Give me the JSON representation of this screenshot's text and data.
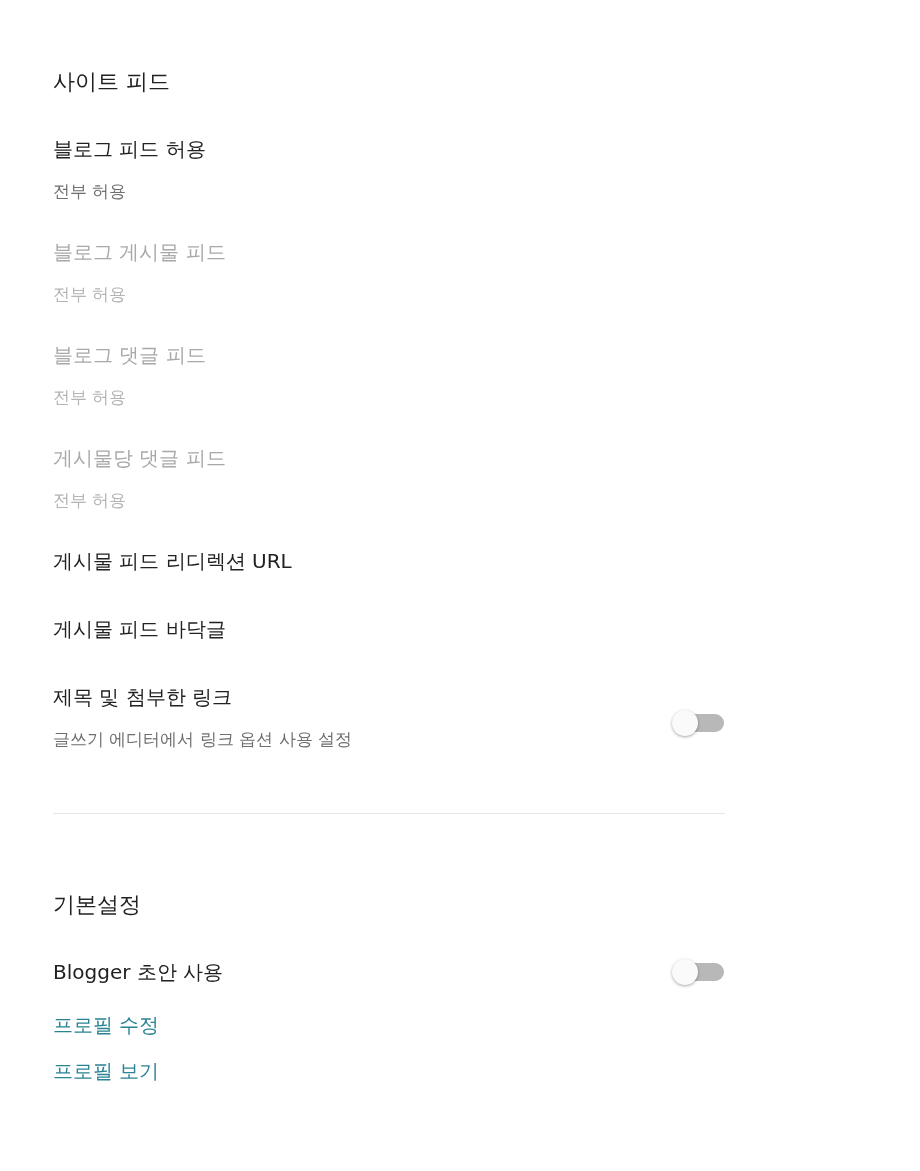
{
  "sections": [
    {
      "title": "사이트 피드",
      "items": [
        {
          "kind": "setting",
          "label": "블로그 피드 허용",
          "value": "전부 허용",
          "disabled": false
        },
        {
          "kind": "setting",
          "label": "블로그 게시물 피드",
          "value": "전부 허용",
          "disabled": true
        },
        {
          "kind": "setting",
          "label": "블로그 댓글 피드",
          "value": "전부 허용",
          "disabled": true
        },
        {
          "kind": "setting",
          "label": "게시물당 댓글 피드",
          "value": "전부 허용",
          "disabled": true
        },
        {
          "kind": "setting",
          "label": "게시물 피드 리디렉션 URL",
          "disabled": false
        },
        {
          "kind": "setting",
          "label": "게시물 피드 바닥글",
          "disabled": false
        },
        {
          "kind": "toggle",
          "label": "제목 및 첨부한 링크",
          "description": "글쓰기 에디터에서 링크 옵션 사용 설정",
          "on": false
        }
      ]
    },
    {
      "title": "기본설정",
      "items": [
        {
          "kind": "toggle",
          "label": "Blogger 초안 사용",
          "on": false
        },
        {
          "kind": "link",
          "label": "프로필 수정"
        },
        {
          "kind": "link",
          "label": "프로필 보기"
        }
      ]
    }
  ]
}
